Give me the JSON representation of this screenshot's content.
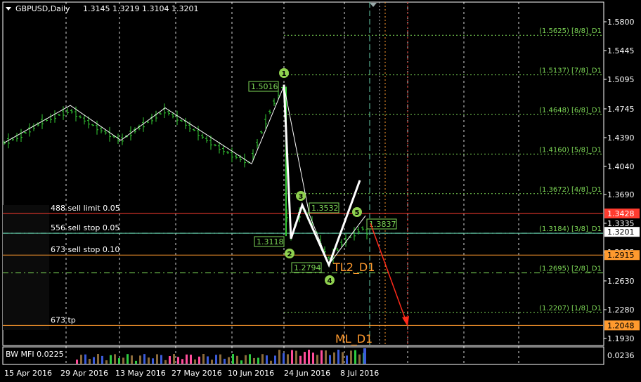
{
  "header": {
    "symbol": "GBPUSD,Daily",
    "ohlc": "1.3145 1.3219 1.3104 1.3201"
  },
  "colors": {
    "background": "#000000",
    "candles": "#33cc33",
    "grid": "#ffffff",
    "murrey": "#7ed957",
    "orders_red": "#ff3b2f",
    "orders_orange": "#ff9a2e",
    "price_box": "#ffffff",
    "teal_line": "#66ccaa"
  },
  "price_axis": {
    "min": 1.17,
    "max": 1.6,
    "labels": [
      "1.5800",
      "1.5445",
      "1.5095",
      "1.4745",
      "1.4390",
      "1.4040",
      "1.3690",
      "1.3335",
      "1.2985",
      "1.2630",
      "1.2280",
      "1.1930"
    ],
    "highlight_labels": [
      {
        "text": "1.3428",
        "price": 1.3428,
        "bg": "#ff3b2f",
        "fg": "#ffffff"
      },
      {
        "text": "1.3201",
        "price": 1.3201,
        "bg": "#ffffff",
        "fg": "#000000"
      },
      {
        "text": "1.2915",
        "price": 1.2915,
        "bg": "#ff9a2e",
        "fg": "#000000"
      },
      {
        "text": "1.2048",
        "price": 1.2048,
        "bg": "#ff9a2e",
        "fg": "#000000"
      }
    ]
  },
  "time_axis": {
    "labels": [
      "15 Apr 2016",
      "29 Apr 2016",
      "13 May 2016",
      "27 May 2016",
      "10 Jun 2016",
      "24 Jun 2016",
      "8 Jul 2016"
    ]
  },
  "murrey_levels": [
    {
      "label": "(1.5625) [8/8]_D1",
      "price": 1.5625
    },
    {
      "label": "(1.5137) [7/8]_D1",
      "price": 1.5137
    },
    {
      "label": "(1.4648) [6/8]_D1",
      "price": 1.4648
    },
    {
      "label": "(1.4160) [5/8]_D1",
      "price": 1.416
    },
    {
      "label": "(1.3672) [4/8]_D1",
      "price": 1.3672
    },
    {
      "label": "(1.3184) [3/8]_D1",
      "price": 1.3184
    },
    {
      "label": "(1.2695) [2/8]_D1",
      "price": 1.2695
    },
    {
      "label": "(1.2207) [1/8]_D1",
      "price": 1.2207
    }
  ],
  "orders": [
    {
      "label": "488 sell limit 0.05",
      "price": 1.3428,
      "color": "#ff3b2f"
    },
    {
      "label": "556 sell stop 0.05",
      "price": 1.3184,
      "color": "#66ccaa"
    },
    {
      "label": "673 sell stop 0.10",
      "price": 1.2915,
      "color": "#ff9a2e"
    },
    {
      "label": "673 tp",
      "price": 1.2048,
      "color": "#ff9a2e"
    }
  ],
  "wave_points": [
    {
      "num": "1",
      "value": "1.5016",
      "price": 1.5016
    },
    {
      "num": "2",
      "value": "1.3118",
      "price": 1.3118
    },
    {
      "num": "3",
      "value": "1.3532",
      "price": 1.3532
    },
    {
      "num": "4",
      "value": "1.2794",
      "price": 1.2794
    },
    {
      "num": "5",
      "value": "1.3837",
      "price": 1.3837
    }
  ],
  "annotations": {
    "tl2": "TL2_D1",
    "ml": "ML_D1"
  },
  "indicator": {
    "title": "BW MFI 0.0225",
    "axis_label": "0.0236"
  }
}
